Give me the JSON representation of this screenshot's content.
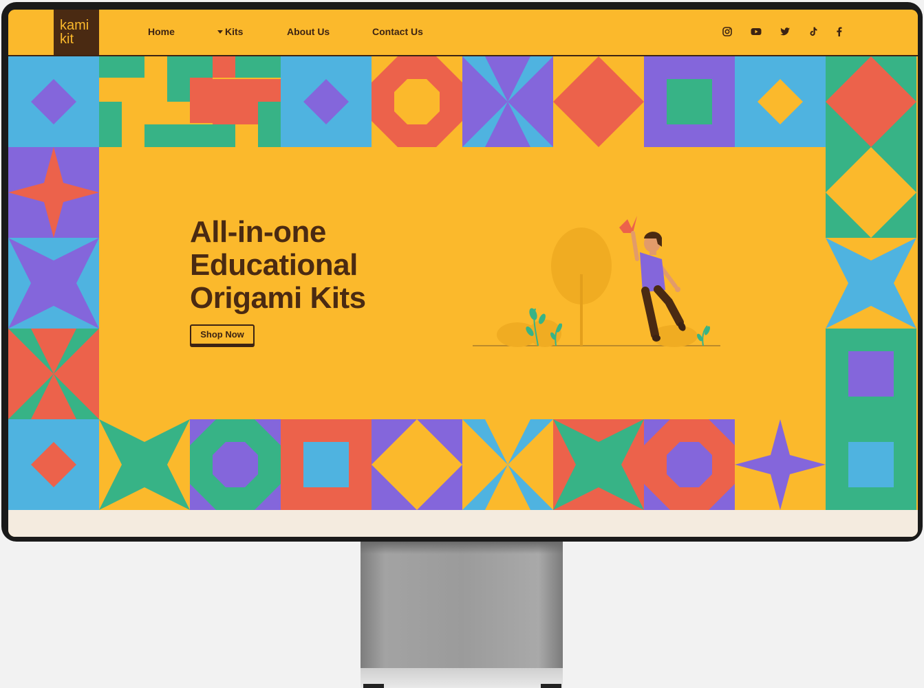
{
  "brand": {
    "logo_line1": "kami",
    "logo_line2": "kit"
  },
  "nav": {
    "items": [
      {
        "label": "Home"
      },
      {
        "label": "Kits",
        "has_dropdown": true
      },
      {
        "label": "About Us"
      },
      {
        "label": "Contact Us"
      }
    ],
    "social_icons": [
      "instagram-icon",
      "youtube-icon",
      "twitter-icon",
      "tiktok-icon",
      "facebook-icon"
    ]
  },
  "hero": {
    "title": "All-in-one\nEducational\nOrigami Kits",
    "cta_label": "Shop Now"
  },
  "colors": {
    "background": "#fbb92c",
    "brown": "#4a2a12",
    "blue": "#4fb3e0",
    "green": "#37b386",
    "red": "#ec624b",
    "purple": "#8466db",
    "cream": "#f4ebdf"
  }
}
